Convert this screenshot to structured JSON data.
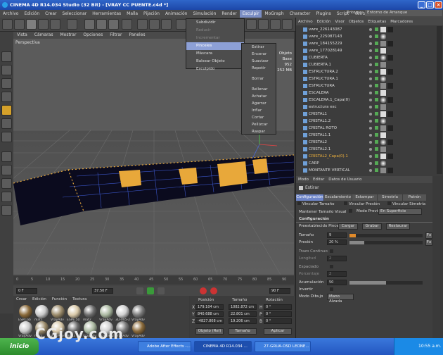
{
  "window": {
    "title": "CINEMA 4D R14.034 Studio (32 Bit) - [VRAY CC PUENTE.c4d *]"
  },
  "menubar": [
    "Archivo",
    "Edición",
    "Crear",
    "Seleccionar",
    "Herramientas",
    "Malla",
    "Pijación",
    "Animación",
    "Simulación",
    "Render",
    "Esculpir",
    "MoGraph",
    "Character",
    "Plugins",
    "Script",
    "Ventana",
    "Ayuda"
  ],
  "menubar_selected_index": 10,
  "environment": {
    "label": "Entorno:",
    "value": "Entorno de Arranque"
  },
  "viewport": {
    "menu": [
      "Vista",
      "Cámaras",
      "Mostrar",
      "Opciones",
      "Filtrar",
      "Paneles"
    ],
    "label": "Perspectiva",
    "info": [
      "Objeto Base",
      "952",
      "252 MB"
    ]
  },
  "sculpt_menu": {
    "items": [
      {
        "label": "Subdividir",
        "enabled": true
      },
      {
        "label": "Reducir",
        "enabled": false
      },
      {
        "label": "Incrementar",
        "enabled": false
      },
      {
        "label": "Pinceles",
        "enabled": true,
        "highlighted": true
      },
      {
        "label": "Máscara",
        "enabled": true
      },
      {
        "label": "Balsear Objeto Esculpido",
        "enabled": true
      }
    ]
  },
  "brushes_menu": {
    "items": [
      "Estirar",
      "Encerar",
      "Suavizar",
      "Repetir",
      "Borrar",
      "Rellenar",
      "Achatar",
      "Agarrar",
      "Inflar",
      "Cortar",
      "Pellizcar",
      "Raspar"
    ]
  },
  "timeline": {
    "ticks": [
      "0",
      "5",
      "10",
      "15",
      "20",
      "25",
      "30",
      "35",
      "40",
      "45",
      "50",
      "55",
      "60",
      "65",
      "70",
      "75",
      "80",
      "85",
      "90"
    ],
    "start_frame": "0 F",
    "current_frame": "37.50 F",
    "end_frame": "90 F",
    "right_frame": "0 F"
  },
  "materials": {
    "menu": [
      "Crear",
      "Edición",
      "Función",
      "Textura"
    ],
    "row1": [
      "ESP.Cob",
      "mat1",
      "VrayAdv",
      "ESPE.50",
      "mat2",
      "VrayAdv",
      "3D-005-2",
      "VrayAdv"
    ],
    "row2": [
      "VrayAdv",
      "mat1",
      "VrayAdv",
      "mat1",
      "VrayAdv",
      "3D-008-2",
      "VrayAdv",
      "VrayAdv"
    ]
  },
  "coords": {
    "headers": [
      "Posición",
      "Tamaño",
      "Rotación"
    ],
    "rows": [
      {
        "axis": "X",
        "pos": "179.104 cm",
        "size": "1082.872 cm",
        "rot_label": "H",
        "rot": "0 °"
      },
      {
        "axis": "Y",
        "pos": "840.688 cm",
        "size": "22.801 cm",
        "rot_label": "P",
        "rot": "0 °"
      },
      {
        "axis": "Z",
        "pos": "-4827.808 cm",
        "size": "19.206 cm",
        "rot_label": "B",
        "rot": "0 °"
      }
    ],
    "mode": "Objeto (Rel)",
    "size_mode": "Tamaño",
    "apply": "Aplicar"
  },
  "objects": {
    "menu": [
      "Archivo",
      "Edición",
      "Visor",
      "Objetos",
      "Etiquetas",
      "Marcadores"
    ],
    "rows": [
      "vwre_226143087",
      "vwre_225087143",
      "vwre_184155229",
      "vwre_177028149",
      "CUBIERTA",
      "CUBIERTA.1",
      "ESTRUCTURA.2",
      "ESTRUCTURA.1",
      "ESTRUCTURA",
      "ESCALERA",
      "ESCALERA.1_Capa(0)",
      "estructura esc",
      "CRISTAL1",
      "CRISTAL1.2",
      "CRISTAL ROTO",
      "CRISTAL1.1",
      "CRISTAL2",
      "CRISTAL2.1",
      "CRISTAL2_Capa(0).1",
      "CARP",
      "MONTANTE VERTICAL"
    ],
    "selected": "CRISTAL2_Capa(0).1"
  },
  "attributes": {
    "menu": [
      "Modo",
      "Editar",
      "Datos de Usuario"
    ],
    "tool": "Estirar",
    "tabs": [
      "Configuración",
      "Escalamiento",
      "Estampar",
      "Simetría",
      "Patrón"
    ],
    "checks": [
      "Vincular Tamaño",
      "Vincular Presión",
      "Vincular Simetría"
    ],
    "keep_size": "Mantener Tamaño Visual",
    "preview_label": "Modo Previo",
    "preview_value": "En Superficie",
    "section": "Configuración",
    "preset_label": "Preestablecido Pincel",
    "preset_buttons": [
      "Cargar",
      "Grabar",
      "Restaurar"
    ],
    "size_label": "Tamaño",
    "size_value": "9",
    "pressure_label": "Presión",
    "pressure_value": "20 %",
    "fields": [
      "Trazo Continuo",
      "Longitud",
      "Espaciado",
      "Porcentaje",
      "Acumulación",
      "Invertir",
      "Modo Dibujo"
    ],
    "length_value": "2",
    "percent_value": "2",
    "accum_value": "50",
    "draw_mode": "Mano Alzada",
    "fx": "Fx",
    "size_fraction": 0.09,
    "pressure_fraction": 0.2,
    "accum_fraction": 0.5
  },
  "taskbar": {
    "start": "inicio",
    "tasks": [
      "Adobe After Effects -...",
      "CINEMA 4D R14.034 ...",
      "27-GRUA-OSD LEONE..."
    ],
    "clock": "10:55 a.m."
  },
  "watermark": "CGjoy.com"
}
